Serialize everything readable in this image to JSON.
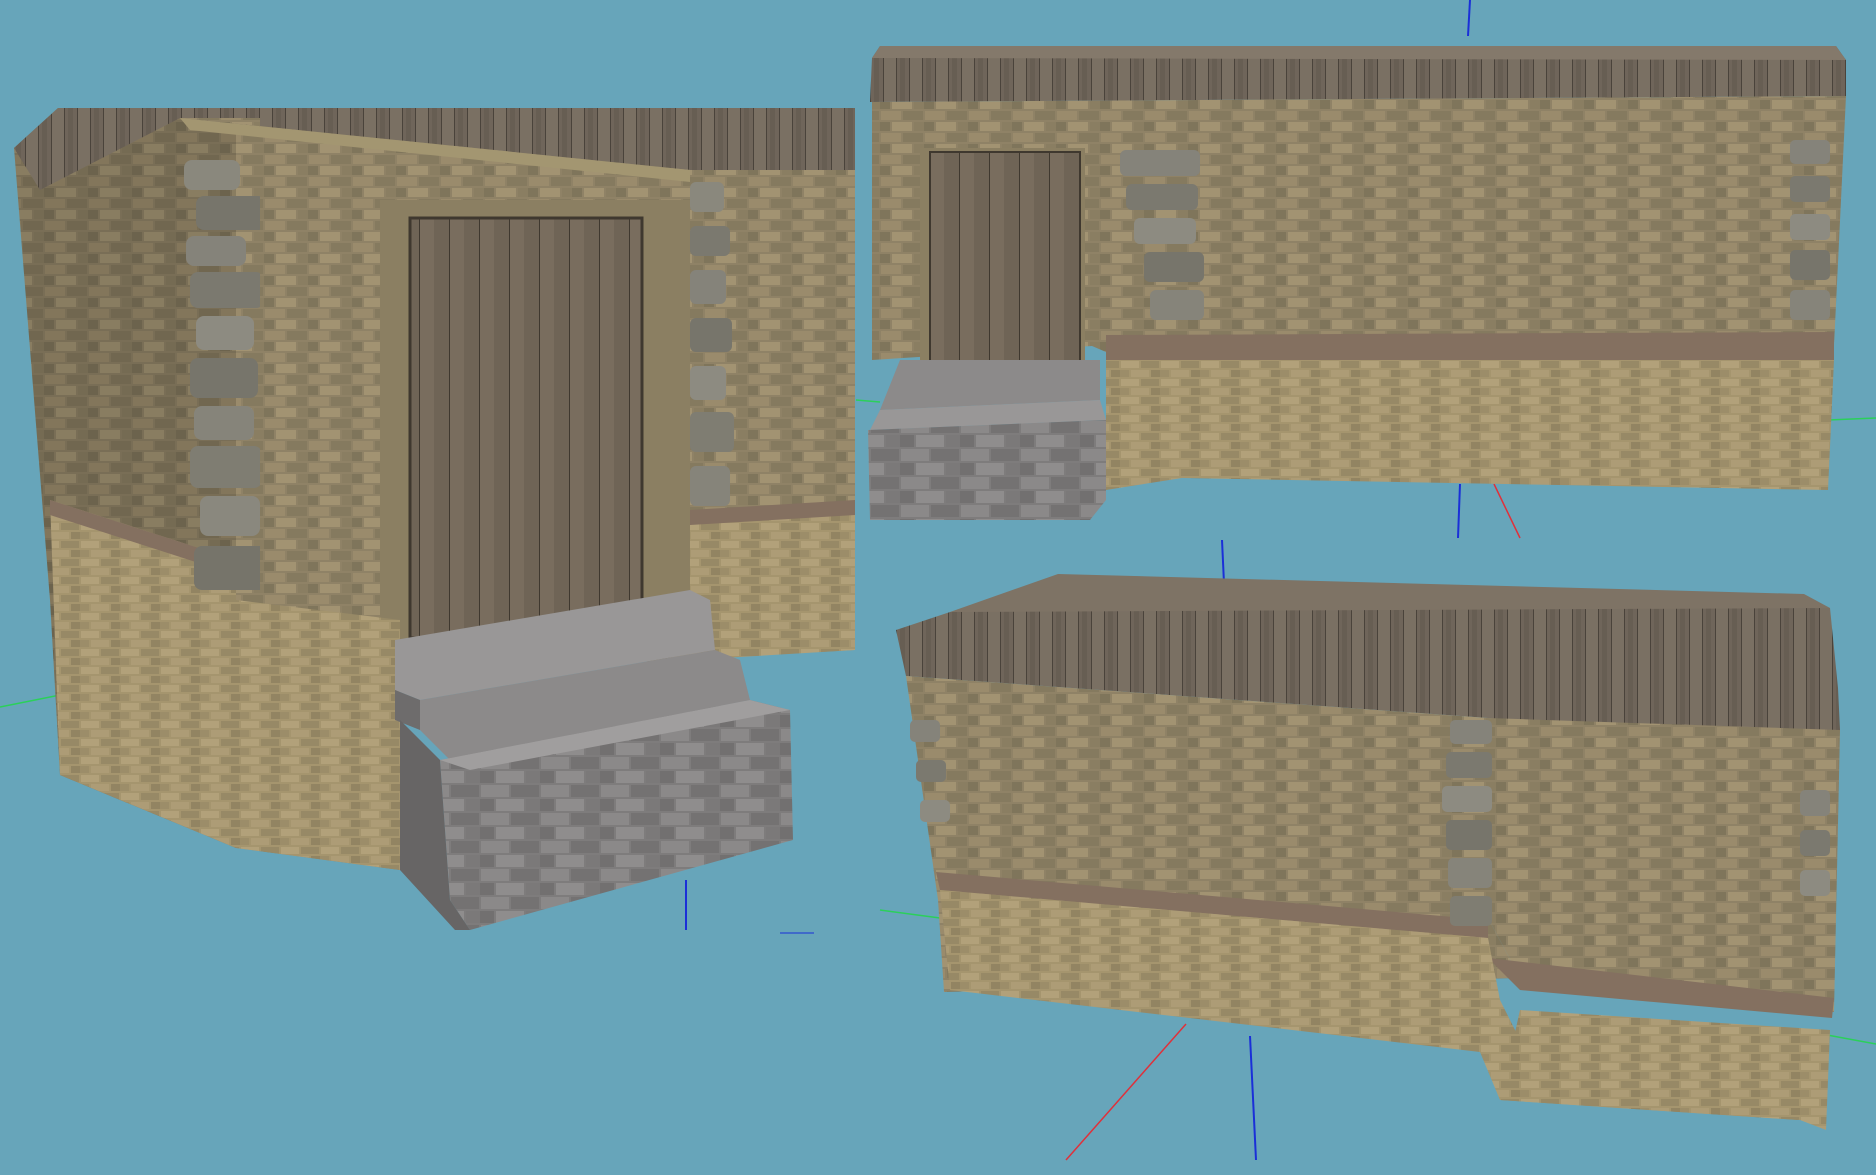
{
  "scene": {
    "background": "#67a5ba",
    "axis_colors": {
      "x": "#e0303a",
      "y": "#2bd05a",
      "z": "#1a2fd8"
    },
    "materials": {
      "stone_wall": "#8f8266",
      "stone_wall_dark": "#6d654f",
      "foundation": "#a5956e",
      "foundation_dark": "#837659",
      "cobble_band": "#847060",
      "wood_roof": "#6f655a",
      "wood_roof_top": "#7e7365",
      "door_wood": "#6f6456",
      "door_frame": "#8b7f62",
      "step_stone": "#7e7c7c",
      "step_stone_top": "#999797",
      "quoin_stone": "#7f7d72"
    },
    "views": [
      {
        "name": "perspective-front-view",
        "object": "stone-house-with-door-and-steps"
      },
      {
        "name": "side-view-door",
        "object": "stone-house-with-door-and-steps"
      },
      {
        "name": "back-view",
        "object": "stone-house-back-wall"
      }
    ]
  }
}
